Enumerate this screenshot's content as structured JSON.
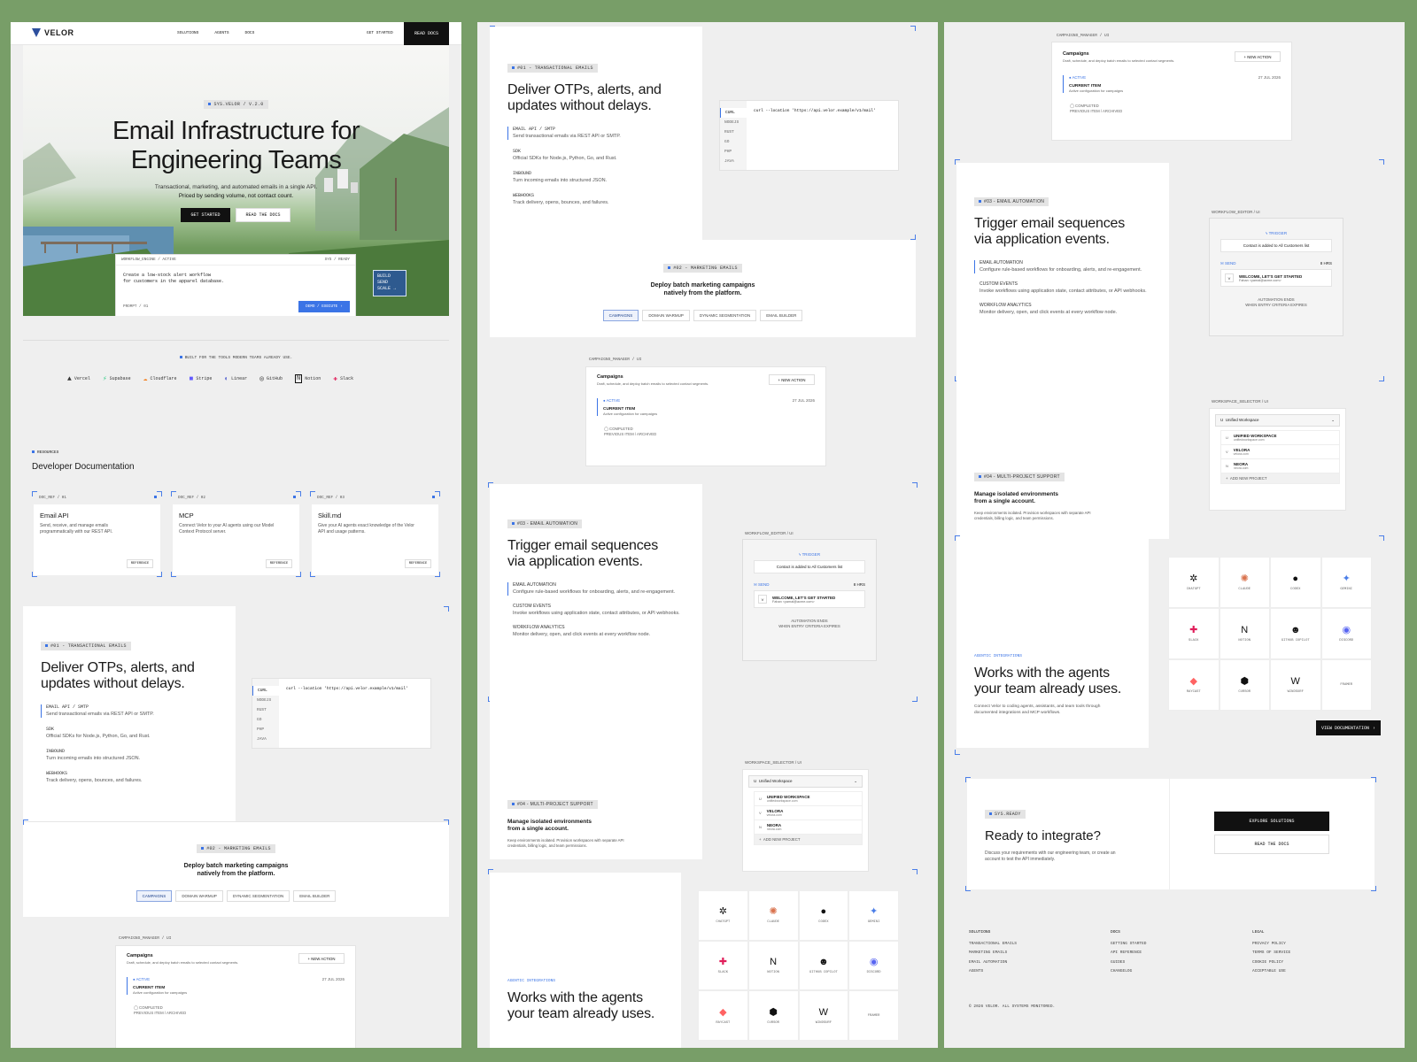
{
  "nav": {
    "logo": "VELOR",
    "links": [
      "SOLUTIONS",
      "AGENTS",
      "DOCS"
    ],
    "get_started": "GET STARTED",
    "read_docs": "READ DOCS"
  },
  "hero": {
    "badge": "SYS.VELOR / V.2.0",
    "title_line1": "Email Infrastructure for",
    "title_line2": "Engineering Teams",
    "sub1": "Transactional, marketing, and automated emails in a single API.",
    "sub2": "Priced by sending volume, not contact count.",
    "cta_primary": "GET STARTED",
    "cta_secondary": "READ THE DOCS",
    "sign": [
      "BUILD",
      "SEND",
      "SCALE"
    ],
    "workflow": {
      "header_left": "WORKFLOW_ENGINE / ACTIVE",
      "header_right": "SYS / READY",
      "prompt_line1": "Create a low-stock alert workflow",
      "prompt_line2": "for customers in the apparel database.",
      "prompt_label": "PROMPT / 01",
      "run_button": "DEMO / EXECUTE"
    }
  },
  "trusted": {
    "label": "BUILT FOR THE TOOLS MODERN TEAMS ALREADY USE.",
    "logos": [
      "Vercel",
      "Supabase",
      "Cloudflare",
      "Stripe",
      "Linear",
      "GitHub",
      "Notion",
      "Slack"
    ]
  },
  "resources": {
    "tag": "RESOURCES",
    "title": "Developer Documentation",
    "cards": [
      {
        "ref": "DOC_REF / 01",
        "title": "Email API",
        "desc": "Send, receive, and manage emails programmatically with our REST API.",
        "button": "REFERENCE"
      },
      {
        "ref": "DOC_REF / 02",
        "title": "MCP",
        "desc": "Connect Velor to your AI agents using our Model Context Protocol server.",
        "button": "REFERENCE"
      },
      {
        "ref": "DOC_REF / 03",
        "title": "Skill.md",
        "desc": "Give your AI agents exact knowledge of the Velor API and usage patterns.",
        "button": "REFERENCE"
      }
    ]
  },
  "transactional": {
    "tag": "#01 - TRANSACTIONAL EMAILS",
    "title_line1": "Deliver OTPs, alerts, and",
    "title_line2": "updates without delays.",
    "features": [
      {
        "name": "EMAIL API / SMTP",
        "desc": "Send transactional emails via REST API or SMTP."
      },
      {
        "name": "SDK",
        "desc": "Official SDKs for Node.js, Python, Go, and Rust."
      },
      {
        "name": "INBOUND",
        "desc": "Turn incoming emails into structured JSON."
      },
      {
        "name": "WEBHOOKS",
        "desc": "Track delivery, opens, bounces, and failures."
      }
    ],
    "langs": [
      "CURL",
      "NODEJS",
      "RUST",
      "GO",
      "PHP",
      "JAVA"
    ],
    "code": "curl --location 'https://api.velor.example/v1/mail'"
  },
  "marketing": {
    "tag": "#02 - MARKETING EMAILS",
    "title_line1": "Deploy batch marketing campaigns",
    "title_line2": "natively from the platform.",
    "tabs": [
      "CAMPAIGNS",
      "DOMAIN WARMUP",
      "DYNAMIC SEGMENTATION",
      "EMAIL BUILDER"
    ]
  },
  "campaigns_ui": {
    "label": "CAMPAIGNS_MANAGER / UI",
    "title": "Campaigns",
    "desc": "Draft, schedule, and deploy batch emails to selected contact segments.",
    "new_action": "NEW ACTION",
    "active_label": "ACTIVE",
    "active_date": "27 JUL 2026",
    "current_item": "CURRENT ITEM",
    "current_desc": "Active configuration for campaigns",
    "completed_label": "COMPLETED",
    "previous_item": "PREVIOUS ITEM / ARCHIVED"
  },
  "automation": {
    "tag": "#03 - EMAIL AUTOMATION",
    "title_line1": "Trigger email sequences",
    "title_line2": "via application events.",
    "features": [
      {
        "name": "EMAIL AUTOMATION",
        "desc": "Configure rule-based workflows for onboarding, alerts, and re-engagement."
      },
      {
        "name": "CUSTOM EVENTS",
        "desc": "Invoke workflows using application state, contact attributes, or API webhooks."
      },
      {
        "name": "WORKFLOW ANALYTICS",
        "desc": "Monitor delivery, open, and click events at every workflow node."
      }
    ],
    "editor_label": "WORKFLOW_EDITOR / UI",
    "trigger_label": "TRIGGER",
    "trigger_text": "Contact is added to All Customers list",
    "send_label": "SEND",
    "delay": "8 HRS",
    "email_title": "WELCOME, LET'S GET STARTED",
    "email_from": "Fahan <yamal@acme.com>",
    "end_line1": "AUTOMATION ENDS",
    "end_line2": "WHEN ENTRY CRITERIA EXPIRES"
  },
  "multiproject": {
    "tag": "#04 - MULTI-PROJECT SUPPORT",
    "title_line1": "Manage isolated environments",
    "title_line2": "from a single account.",
    "desc": "Keep environments isolated. Provision workspaces with separate API credentials, billing logic, and team permissions.",
    "selector_label": "WORKSPACE_SELECTOR / UI",
    "selected": "Unified Workspace",
    "workspaces": [
      {
        "initial": "U",
        "name": "UNIFIED WORKSPACE",
        "domain": "unifiedworkspace.com"
      },
      {
        "initial": "V",
        "name": "VELORA",
        "domain": "velora.com"
      },
      {
        "initial": "N",
        "name": "NEORA",
        "domain": "neora.com"
      }
    ],
    "add": "ADD NEW PROJECT"
  },
  "agents": {
    "tag": "AGENTIC INTEGRATIONS",
    "title_line1": "Works with the agents",
    "title_line2": "your team already uses.",
    "desc": "Connect Velor to coding agents, assistants, and team tools through documented integrations and MCP workflows.",
    "items": [
      {
        "name": "CHATGPT",
        "icon": "chatgpt-icon",
        "glyph": "✲",
        "color": "#111111"
      },
      {
        "name": "CLAUDE",
        "icon": "claude-icon",
        "glyph": "✺",
        "color": "#d9734e"
      },
      {
        "name": "CODEX",
        "icon": "codex-icon",
        "glyph": "●",
        "color": "#111111"
      },
      {
        "name": "GEMINI",
        "icon": "gemini-icon",
        "glyph": "✦",
        "color": "#4a7ee8"
      },
      {
        "name": "SLACK",
        "icon": "slack-icon",
        "glyph": "✚",
        "color": "#e01e5a"
      },
      {
        "name": "NOTION",
        "icon": "notion-icon",
        "glyph": "N",
        "color": "#111111"
      },
      {
        "name": "GITHUB COPILOT",
        "icon": "copilot-icon",
        "glyph": "☻",
        "color": "#111111"
      },
      {
        "name": "DISCORD",
        "icon": "discord-icon",
        "glyph": "◉",
        "color": "#5865f2"
      },
      {
        "name": "RAYCAST",
        "icon": "raycast-icon",
        "glyph": "◆",
        "color": "#ff6363"
      },
      {
        "name": "CURSOR",
        "icon": "cursor-icon",
        "glyph": "⬢",
        "color": "#111111"
      },
      {
        "name": "WINDSURF",
        "icon": "windsurf-icon",
        "glyph": "W",
        "color": "#111111"
      },
      {
        "name": "FRAMER",
        "icon": "framer-icon",
        "glyph": "",
        "color": "#111111"
      }
    ],
    "docs_button": "VIEW DOCUMENTATION"
  },
  "cta": {
    "tag": "SYS.READY",
    "title": "Ready to integrate?",
    "desc": "Discuss your requirements with our engineering team, or create an account to test the API immediately.",
    "primary": "EXPLORE SOLUTIONS",
    "secondary": "READ THE DOCS"
  },
  "footer": {
    "columns": [
      {
        "title": "SOLUTIONS",
        "links": [
          "TRANSACTIONAL EMAILS",
          "MARKETING EMAILS",
          "EMAIL AUTOMATION",
          "AGENTS"
        ]
      },
      {
        "title": "DOCS",
        "links": [
          "GETTING STARTED",
          "API REFERENCE",
          "GUIDES",
          "CHANGELOG"
        ]
      },
      {
        "title": "LEGAL",
        "links": [
          "PRIVACY POLICY",
          "TERMS OF SERVICE",
          "COOKIE POLICY",
          "ACCEPTABLE USE"
        ]
      }
    ],
    "copyright": "© 2026 VELOR. ALL SYSTEMS MONITORED."
  }
}
